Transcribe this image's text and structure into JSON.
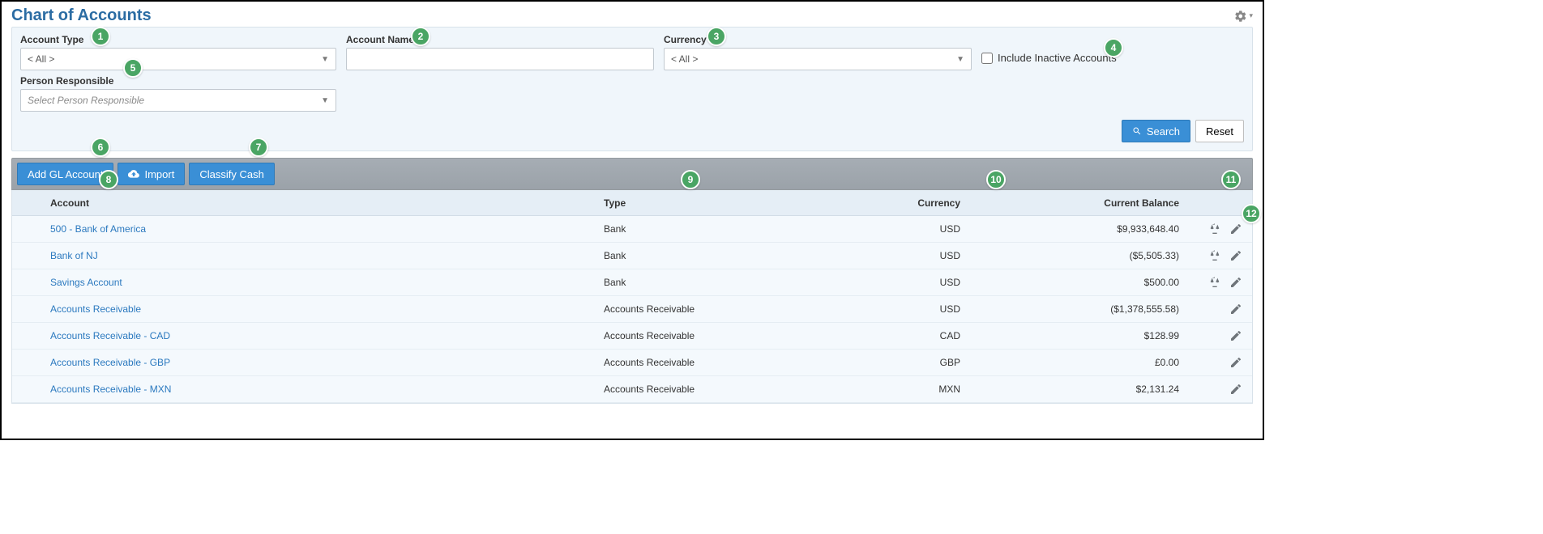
{
  "title": "Chart of Accounts",
  "filters": {
    "account_type": {
      "label": "Account Type",
      "value": "< All >"
    },
    "account_name": {
      "label": "Account Name",
      "value": ""
    },
    "currency": {
      "label": "Currency",
      "value": "< All >"
    },
    "inactive": {
      "label": "Include Inactive Accounts"
    },
    "person": {
      "label": "Person Responsible",
      "placeholder": "Select Person Responsible"
    }
  },
  "buttons": {
    "search": "Search",
    "reset": "Reset",
    "add_gl": "Add GL Account",
    "import": "Import",
    "classify": "Classify Cash"
  },
  "columns": {
    "account": "Account",
    "type": "Type",
    "currency": "Currency",
    "balance": "Current Balance"
  },
  "rows": [
    {
      "account": "500 - Bank of America",
      "type": "Bank",
      "currency": "USD",
      "balance": "$9,933,648.40",
      "has_balance_icon": true
    },
    {
      "account": "Bank of NJ",
      "type": "Bank",
      "currency": "USD",
      "balance": "($5,505.33)",
      "has_balance_icon": true
    },
    {
      "account": "Savings Account",
      "type": "Bank",
      "currency": "USD",
      "balance": "$500.00",
      "has_balance_icon": true
    },
    {
      "account": "Accounts Receivable",
      "type": "Accounts Receivable",
      "currency": "USD",
      "balance": "($1,378,555.58)",
      "has_balance_icon": false
    },
    {
      "account": "Accounts Receivable - CAD",
      "type": "Accounts Receivable",
      "currency": "CAD",
      "balance": "$128.99",
      "has_balance_icon": false
    },
    {
      "account": "Accounts Receivable - GBP",
      "type": "Accounts Receivable",
      "currency": "GBP",
      "balance": "£0.00",
      "has_balance_icon": false
    },
    {
      "account": "Accounts Receivable - MXN",
      "type": "Accounts Receivable",
      "currency": "MXN",
      "balance": "$2,131.24",
      "has_balance_icon": false
    }
  ],
  "badges": [
    "1",
    "2",
    "3",
    "4",
    "5",
    "6",
    "7",
    "8",
    "9",
    "10",
    "11",
    "12"
  ]
}
